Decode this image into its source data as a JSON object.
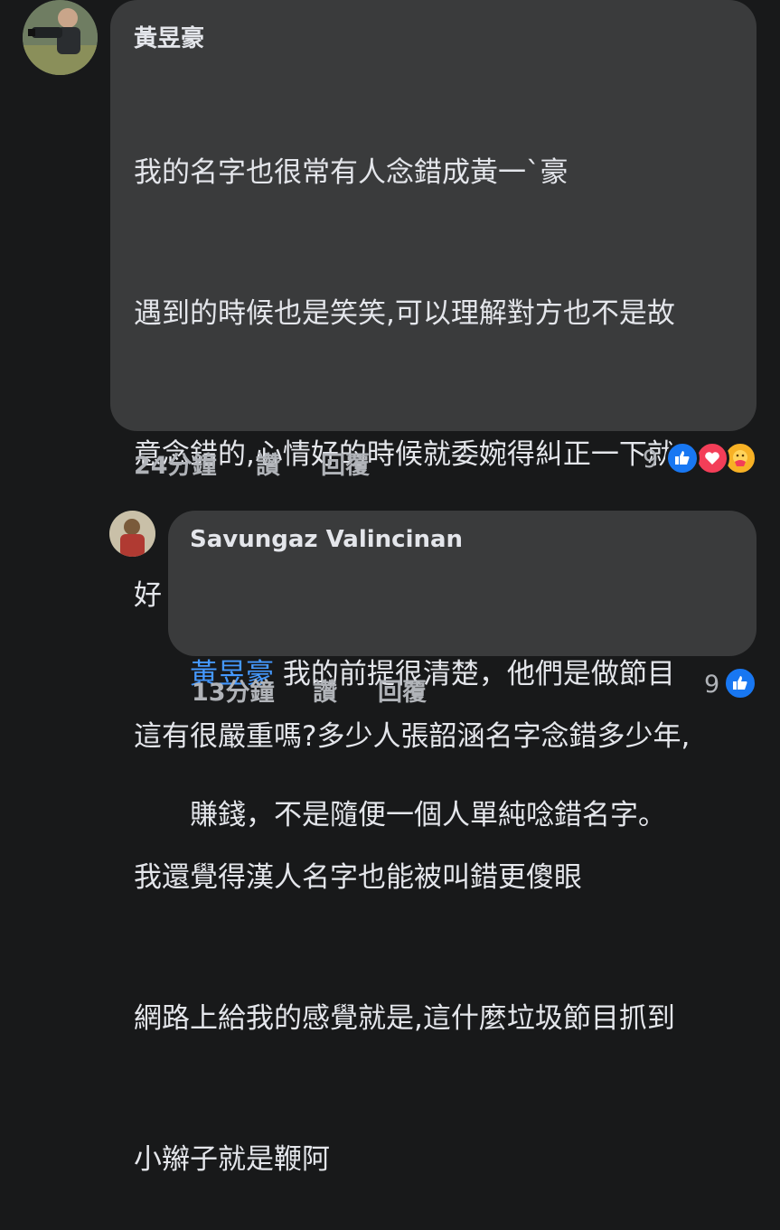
{
  "comment": {
    "author": "黃昱豪",
    "lines": [
      "我的名字也很常有人念錯成黃一`豪",
      "遇到的時候也是笑笑,可以理解對方也不是故",
      "意念錯的,心情好的時候就委婉得糾正一下就",
      "好",
      "這有很嚴重嗎?多少人張韶涵名字念錯多少年,",
      "我還覺得漢人名字也能被叫錯更傻眼",
      "網路上給我的感覺就是,這什麼垃圾節目抓到",
      "小辮子就是鞭阿"
    ],
    "time": "24分鐘",
    "like_label": "讚",
    "reply_label": "回覆",
    "reaction_count": "9",
    "reactions": [
      "like-icon",
      "love-icon",
      "care-icon"
    ]
  },
  "reply": {
    "author": "Savungaz Valincinan",
    "mention": "黃昱豪",
    "line1_rest": " 我的前提很清楚，他們是做節目",
    "line2": "賺錢，不是隨便一個人單純唸錯名字。",
    "time": "13分鐘",
    "like_label": "讚",
    "reply_label": "回覆",
    "reaction_count": "9",
    "reactions": [
      "like-icon"
    ]
  },
  "colors": {
    "background": "#18191a",
    "bubble": "#3a3b3c",
    "mention": "#4599ff",
    "like": "#1877f2",
    "love": "#f33e58",
    "care": "#f7b125"
  }
}
